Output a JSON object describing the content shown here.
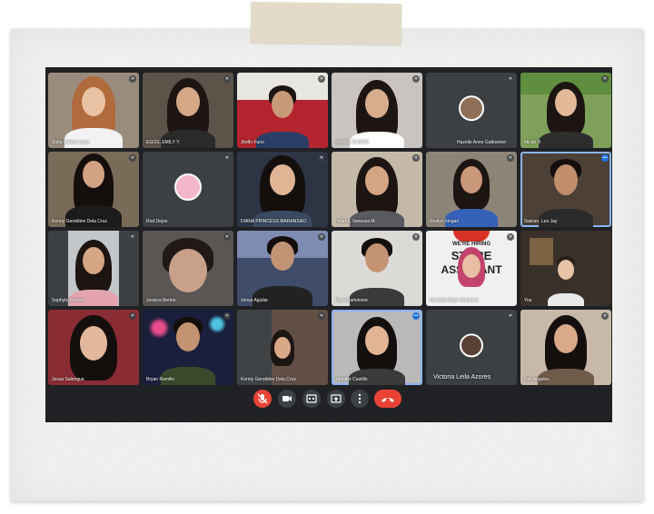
{
  "participants": [
    {
      "name": "Sofia Isabel Lopez"
    },
    {
      "name": "EGOS, EMILY Y."
    },
    {
      "name": "Jhello Furio"
    },
    {
      "name": "SAMSI, EUNICE"
    },
    {
      "name": "Hazelle Anne Gatbonton"
    },
    {
      "name": "Micah R"
    },
    {
      "name": "Kenny Geraldine Dela Cruz"
    },
    {
      "name": "Rod Dejos"
    },
    {
      "name": "DIANA PRINCESS MARANSAO"
    },
    {
      "name": "Hebres, Vanessa M."
    },
    {
      "name": "Realyn Iringan"
    },
    {
      "name": "Sisican, Leo Jay"
    },
    {
      "name": "Sophyla Briones"
    },
    {
      "name": "Jessica Bertos"
    },
    {
      "name": "Jonas Aguilar"
    },
    {
      "name": "Ryan Bartolome"
    },
    {
      "name": "Hannah Claire Gutierrez"
    },
    {
      "name": "You"
    },
    {
      "name": "Jessa Salengua"
    },
    {
      "name": "Bryan Ramillo"
    },
    {
      "name": "Kenny Geraldine Dela Cruz"
    },
    {
      "name": "Jennifer Castillo"
    },
    {
      "name": "Victoria Leila Azores"
    },
    {
      "name": "Kim Angeles"
    }
  ],
  "banner_text": {
    "line1": "WE'RE HIRING",
    "line2": "STORE",
    "line3": "ASSISTANT"
  },
  "icons": {
    "mic": "mic-off-icon",
    "camera": "camera-icon",
    "captions": "captions-icon",
    "present": "present-icon",
    "more": "more-icon",
    "end": "end-call-icon"
  },
  "colors": {
    "background": "#202124",
    "tile": "#3c4043",
    "end": "#ea4335",
    "accent": "#8ab4f8"
  }
}
